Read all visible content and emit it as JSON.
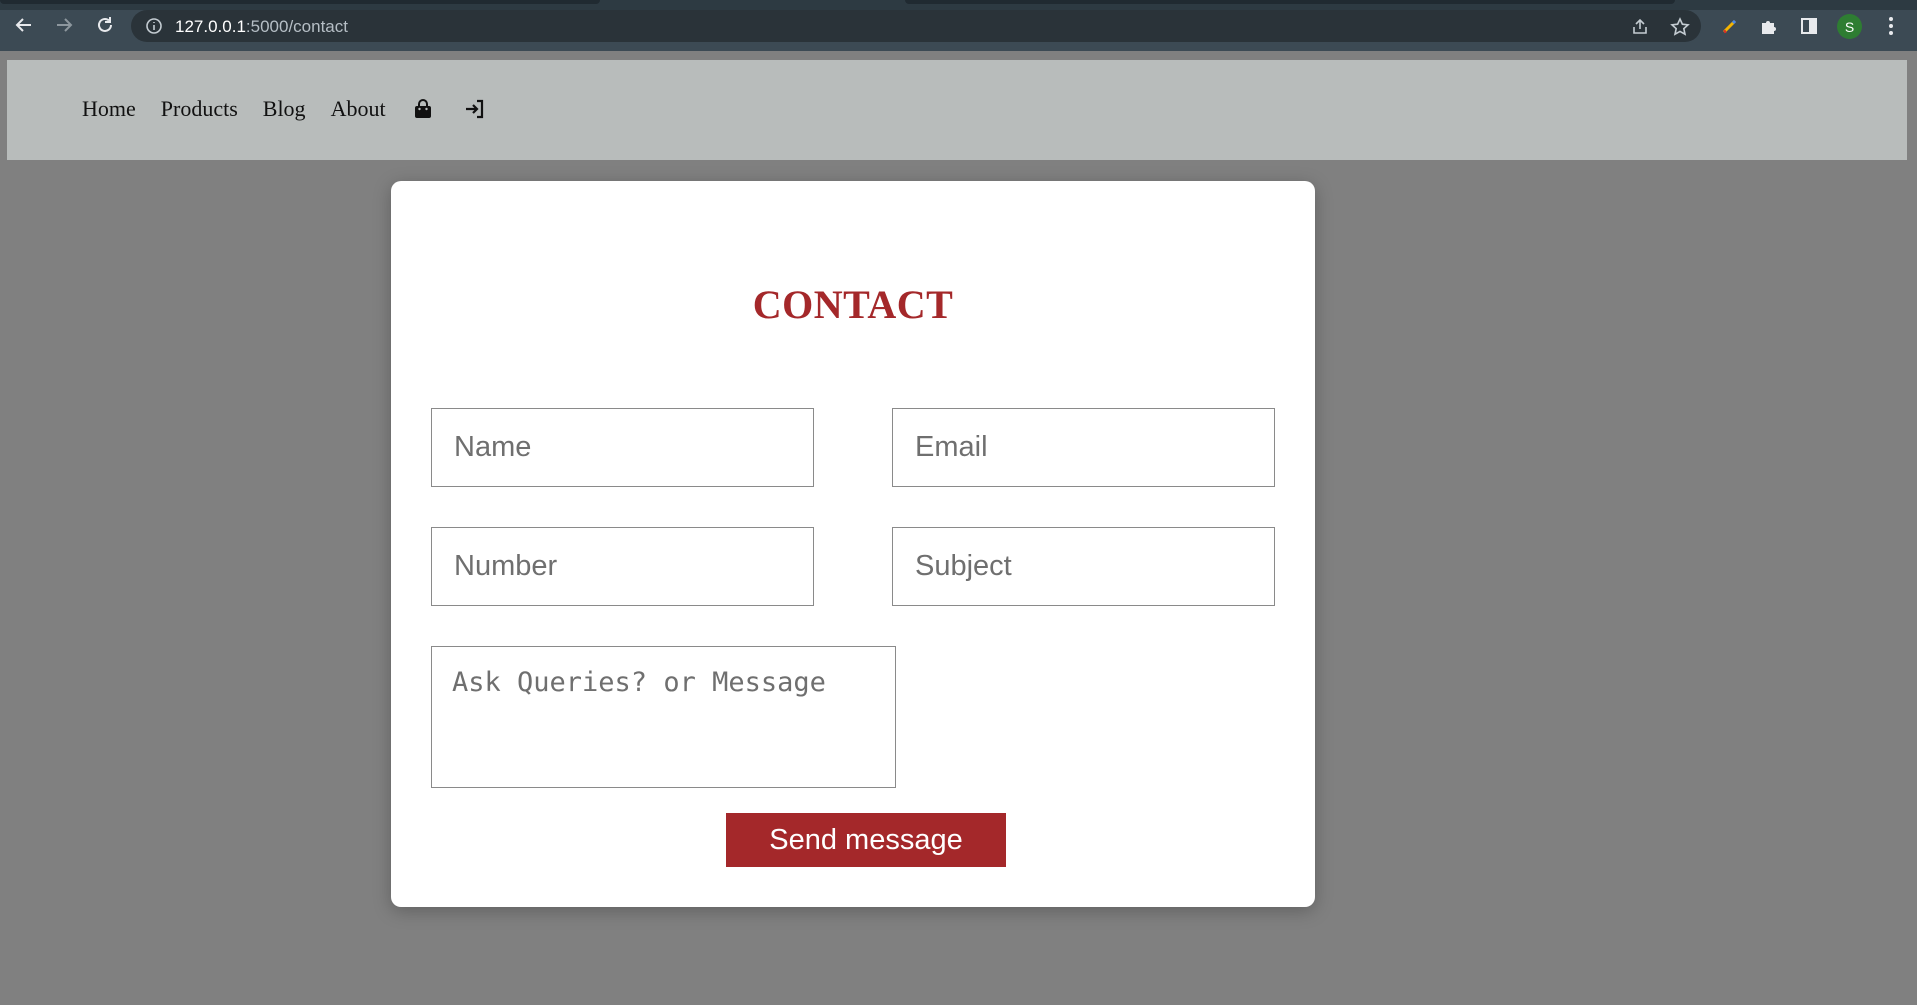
{
  "browser": {
    "url_host": "127.0.0.1",
    "url_path": ":5000/contact",
    "profile_initial": "S",
    "avatar_color": "#2e7d32"
  },
  "nav": {
    "links": [
      "Home",
      "Products",
      "Blog",
      "About"
    ],
    "icons": [
      "shopping-bag-icon",
      "sign-in-icon"
    ]
  },
  "contact": {
    "title": "CONTACT",
    "name_placeholder": "Name",
    "email_placeholder": "Email",
    "number_placeholder": "Number",
    "subject_placeholder": "Subject",
    "message_placeholder": "Ask Queries? or Message",
    "send_label": "Send message"
  },
  "colors": {
    "accent": "#a4282a",
    "page_bg": "#808080",
    "nav_bg": "#b8bcbb"
  }
}
